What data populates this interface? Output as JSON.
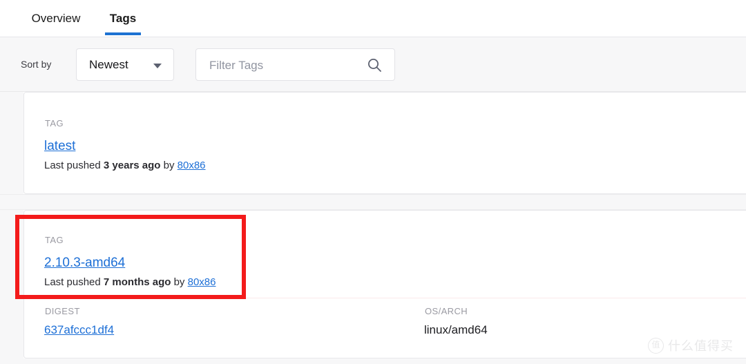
{
  "tabs": [
    {
      "label": "Overview",
      "active": false
    },
    {
      "label": "Tags",
      "active": true
    }
  ],
  "toolbar": {
    "sort_label": "Sort by",
    "sort_value": "Newest",
    "caret_icon": "chevron-down-icon",
    "filter_value": "",
    "filter_placeholder": "Filter Tags",
    "search_icon": "search-icon"
  },
  "tag_cards": [
    {
      "tag_label": "TAG",
      "tag_name": "latest",
      "pushed_prefix": "Last pushed",
      "pushed_time": "3 years ago",
      "pushed_by_word": "by",
      "pushed_author": "80x86"
    },
    {
      "tag_label": "TAG",
      "tag_name": "2.10.3-amd64",
      "pushed_prefix": "Last pushed",
      "pushed_time": "7 months ago",
      "pushed_by_word": "by",
      "pushed_author": "80x86",
      "digest_label": "DIGEST",
      "digest_value": "637afccc1df4",
      "osarch_label": "OS/ARCH",
      "osarch_value": "linux/amd64"
    }
  ],
  "annotation": {
    "highlight_color": "#f31b1b"
  },
  "watermark": {
    "logo_glyph": "值",
    "text": "什么值得买"
  },
  "colors": {
    "accent_blue": "#1d72d2",
    "link_blue": "#1d6fd6",
    "page_bg": "#f7f7f8"
  }
}
